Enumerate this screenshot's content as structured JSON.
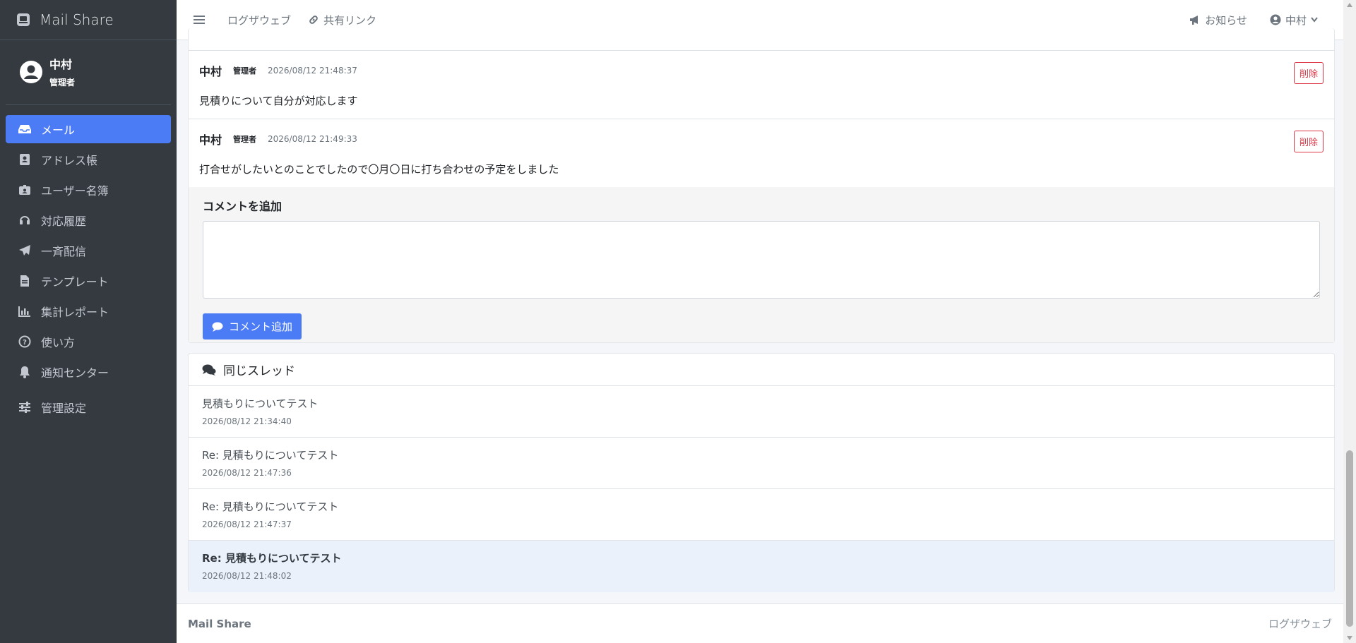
{
  "app": {
    "title": "Mail Share"
  },
  "user": {
    "name": "中村",
    "role": "管理者"
  },
  "sidebar": {
    "items": [
      {
        "label": "メール",
        "icon": "inbox-icon",
        "active": true
      },
      {
        "label": "アドレス帳",
        "icon": "address-book-icon"
      },
      {
        "label": "ユーザー名簿",
        "icon": "id-badge-icon"
      },
      {
        "label": "対応履歴",
        "icon": "headset-icon"
      },
      {
        "label": "一斉配信",
        "icon": "paper-plane-icon"
      },
      {
        "label": "テンプレート",
        "icon": "file-icon"
      },
      {
        "label": "集計レポート",
        "icon": "bar-chart-icon"
      },
      {
        "label": "使い方",
        "icon": "question-circle-icon"
      },
      {
        "label": "通知センター",
        "icon": "bell-icon"
      },
      {
        "label": "管理設定",
        "icon": "sliders-icon"
      }
    ]
  },
  "topbar": {
    "links": [
      "ログザウェブ",
      "共有リンク"
    ],
    "notice": "お知らせ",
    "user": "中村"
  },
  "comments": [
    {
      "name": "中村",
      "badge": "管理者",
      "time": "2026/08/12 21:48:37",
      "body": "見積りについて自分が対応します",
      "delete_label": "削除"
    },
    {
      "name": "中村",
      "badge": "管理者",
      "time": "2026/08/12 21:49:33",
      "body": "打合せがしたいとのことでしたので〇月〇日に打ち合わせの予定をしました",
      "delete_label": "削除"
    }
  ],
  "add_comment": {
    "label": "コメントを追加",
    "value": "",
    "button_label": "コメント追加"
  },
  "thread": {
    "title": "同じスレッド",
    "items": [
      {
        "subject": "見積もりについてテスト",
        "date": "2026/08/12 21:34:40"
      },
      {
        "subject": "Re: 見積もりについてテスト",
        "date": "2026/08/12 21:47:36"
      },
      {
        "subject": "Re: 見積もりについてテスト",
        "date": "2026/08/12 21:47:37"
      },
      {
        "subject": "Re: 見積もりについてテスト",
        "date": "2026/08/12 21:48:02",
        "active": true
      }
    ]
  },
  "footer": {
    "left": "Mail Share",
    "right": "ログザウェブ"
  },
  "colors": {
    "sidebar_bg": "#343a40",
    "accent": "#4c7cf5",
    "danger": "#dc3545"
  }
}
